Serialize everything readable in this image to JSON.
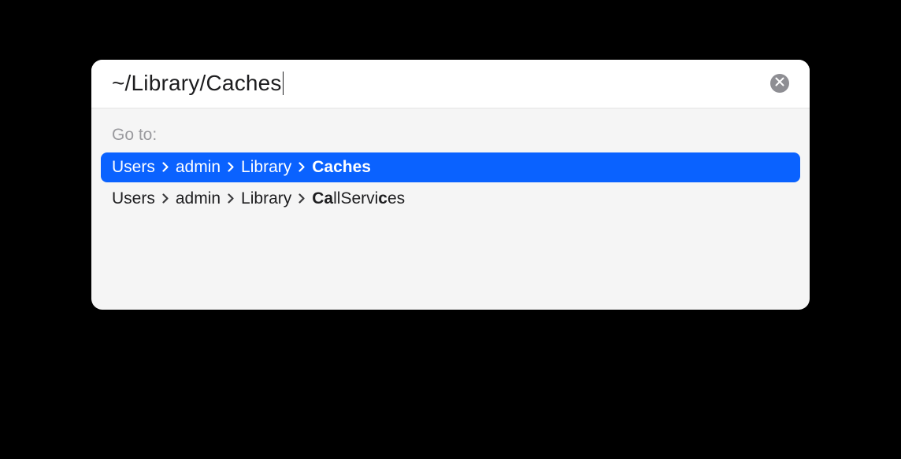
{
  "search": {
    "value": "~/Library/Caches"
  },
  "sectionLabel": "Go to:",
  "results": [
    {
      "selected": true,
      "segments": [
        {
          "text": "Users",
          "bold": false
        },
        {
          "text": "admin",
          "bold": false
        },
        {
          "text": "Library",
          "bold": false
        },
        {
          "text": "Caches",
          "bold": true
        }
      ]
    },
    {
      "selected": false,
      "segments": [
        {
          "text": "Users",
          "bold": false
        },
        {
          "text": "admin",
          "bold": false
        },
        {
          "text": "Library",
          "bold": false
        },
        {
          "parts": [
            {
              "text": "Ca",
              "bold": true
            },
            {
              "text": "llServi",
              "bold": false
            },
            {
              "text": "c",
              "bold": true
            },
            {
              "text": "es",
              "bold": false
            }
          ]
        }
      ]
    }
  ]
}
